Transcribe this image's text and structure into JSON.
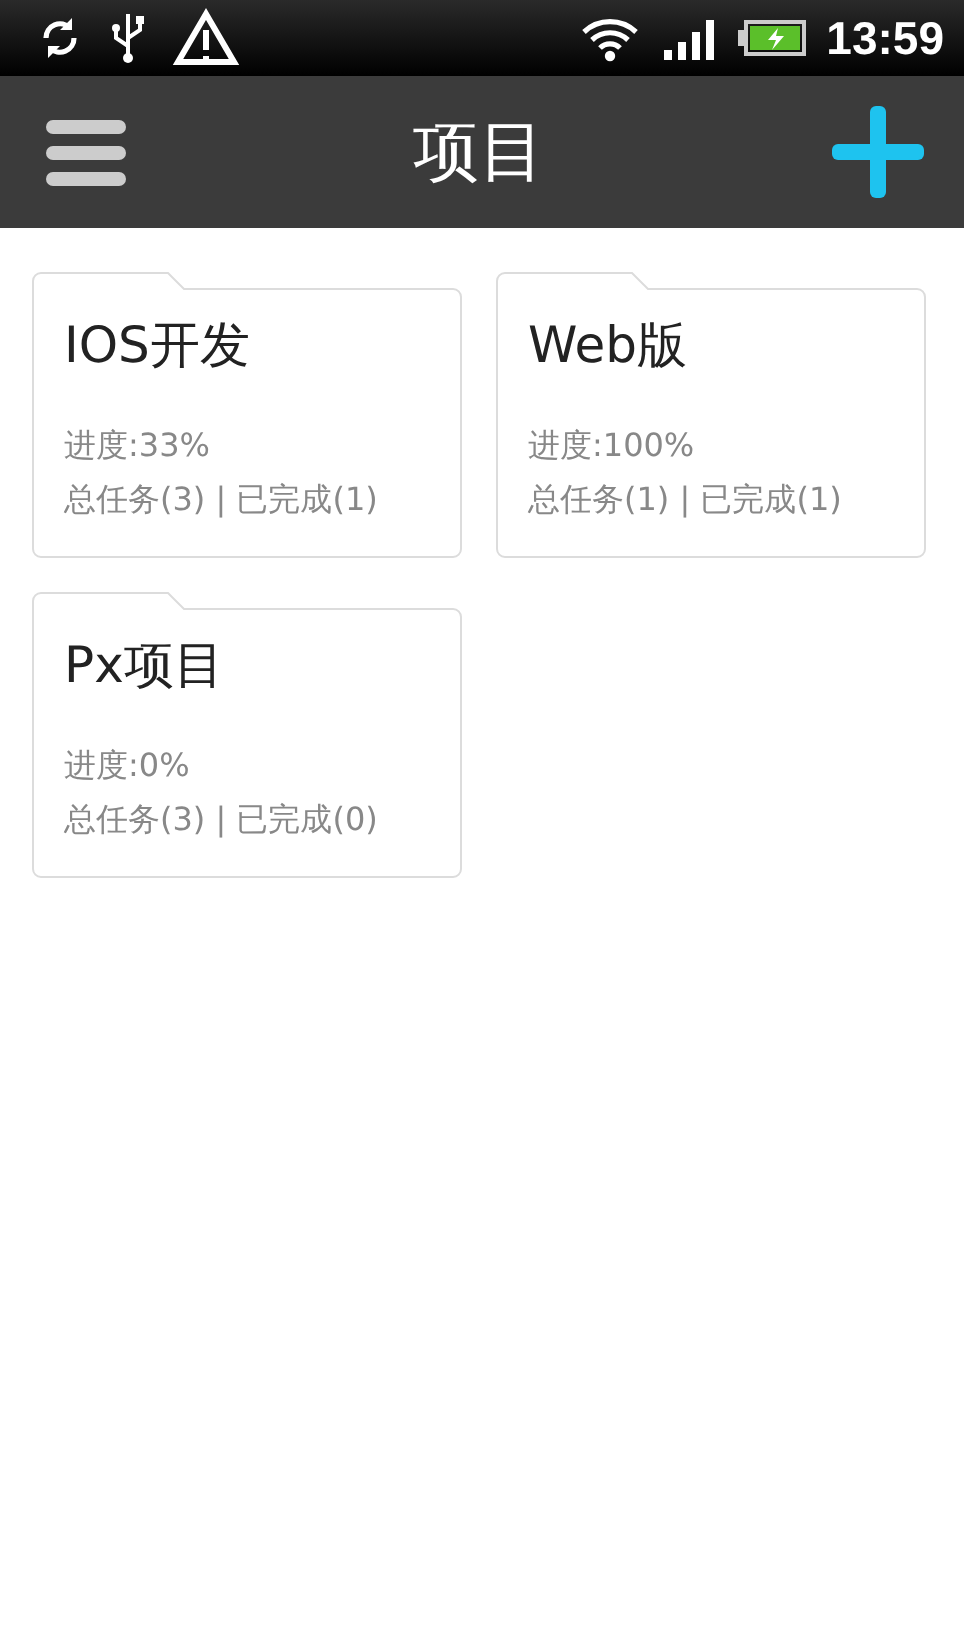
{
  "status_bar": {
    "time": "13:59"
  },
  "action_bar": {
    "title": "项目"
  },
  "projects": [
    {
      "name": "IOS开发",
      "progress": "进度:33%",
      "summary": "总任务(3) | 已完成(1)"
    },
    {
      "name": "Web版",
      "progress": "进度:100%",
      "summary": "总任务(1) | 已完成(1)"
    },
    {
      "name": "Px项目",
      "progress": "进度:0%",
      "summary": "总任务(3) | 已完成(0)"
    }
  ]
}
